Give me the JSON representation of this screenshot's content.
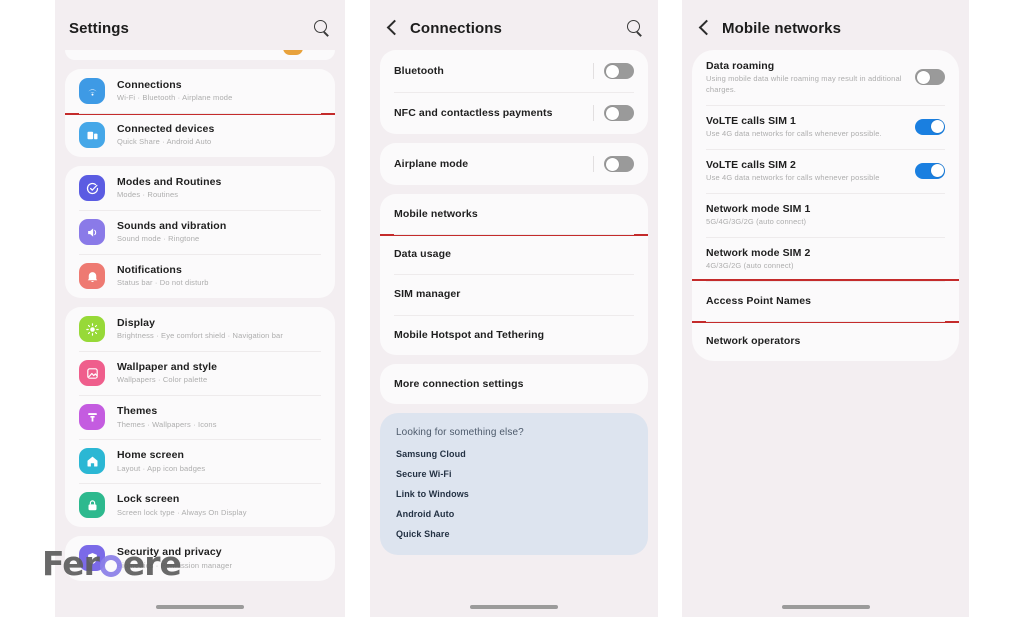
{
  "watermark": {
    "text_before": "Fer",
    "text_after": "ere",
    "badge": "o-circle-icon"
  },
  "colors": {
    "accent_blue": "#1a7fe0",
    "highlight_red": "#c42b2b",
    "panel_bg": "#f3eef1",
    "card_bg": "#fbfafb",
    "suggest_bg": "#dde4ef"
  },
  "panel_settings": {
    "header": {
      "title": "Settings",
      "search_icon": "search-icon"
    },
    "groups": [
      {
        "items": [
          {
            "label": "Connections",
            "sub": "Wi-Fi · Bluetooth · Airplane mode",
            "icon": "wifi-icon",
            "color": "#3e9ae5",
            "highlighted": true
          },
          {
            "label": "Connected devices",
            "sub": "Quick Share · Android Auto",
            "icon": "devices-icon",
            "color": "#45a7e8",
            "highlighted": false
          }
        ]
      },
      {
        "items": [
          {
            "label": "Modes and Routines",
            "sub": "Modes · Routines",
            "icon": "modes-check-icon",
            "color": "#5b5ce2",
            "highlighted": false
          },
          {
            "label": "Sounds and vibration",
            "sub": "Sound mode · Ringtone",
            "icon": "speaker-icon",
            "color": "#8a7ae8",
            "highlighted": false
          },
          {
            "label": "Notifications",
            "sub": "Status bar · Do not disturb",
            "icon": "bell-icon",
            "color": "#ee7a72",
            "highlighted": false
          }
        ]
      },
      {
        "items": [
          {
            "label": "Display",
            "sub": "Brightness · Eye comfort shield · Navigation bar",
            "icon": "brightness-icon",
            "color": "#97d938",
            "highlighted": false
          },
          {
            "label": "Wallpaper and style",
            "sub": "Wallpapers · Color palette",
            "icon": "image-icon",
            "color": "#ef5e8c",
            "highlighted": false
          },
          {
            "label": "Themes",
            "sub": "Themes · Wallpapers · Icons",
            "icon": "themes-icon",
            "color": "#c45ce0",
            "highlighted": false
          },
          {
            "label": "Home screen",
            "sub": "Layout · App icon badges",
            "icon": "home-icon",
            "color": "#2bb7d4",
            "highlighted": false
          },
          {
            "label": "Lock screen",
            "sub": "Screen lock type · Always On Display",
            "icon": "lock-icon",
            "color": "#2db98e",
            "highlighted": false
          }
        ]
      },
      {
        "items": [
          {
            "label": "Security and privacy",
            "sub": "Biometrics · Permission manager",
            "icon": "shield-icon",
            "color": "#7b6ae8",
            "highlighted": false
          }
        ]
      }
    ]
  },
  "panel_connections": {
    "header": {
      "title": "Connections",
      "back_icon": "back-chevron-icon",
      "search_icon": "search-icon"
    },
    "groups": [
      {
        "items": [
          {
            "label": "Bluetooth",
            "toggle": "off",
            "highlighted": false
          },
          {
            "label": "NFC and contactless payments",
            "toggle": "off",
            "highlighted": false
          }
        ]
      },
      {
        "items": [
          {
            "label": "Airplane mode",
            "toggle": "off",
            "highlighted": false
          }
        ]
      },
      {
        "items": [
          {
            "label": "Mobile networks",
            "toggle": "none",
            "highlighted": true
          },
          {
            "label": "Data usage",
            "toggle": "none",
            "highlighted": false
          },
          {
            "label": "SIM manager",
            "toggle": "none",
            "highlighted": false
          },
          {
            "label": "Mobile Hotspot and Tethering",
            "toggle": "none",
            "highlighted": false
          }
        ]
      },
      {
        "items": [
          {
            "label": "More connection settings",
            "toggle": "none",
            "highlighted": false
          }
        ]
      }
    ],
    "suggest": {
      "title": "Looking for something else?",
      "items": [
        "Samsung Cloud",
        "Secure Wi-Fi",
        "Link to Windows",
        "Android Auto",
        "Quick Share"
      ]
    }
  },
  "panel_mobile": {
    "header": {
      "title": "Mobile networks",
      "back_icon": "back-chevron-icon"
    },
    "items": [
      {
        "label": "Data roaming",
        "sub": "Using mobile data while roaming may result in additional charges.",
        "toggle": "off",
        "highlighted": false
      },
      {
        "label": "VoLTE calls SIM 1",
        "sub": "Use 4G data networks for calls whenever possible.",
        "toggle": "on",
        "highlighted": false
      },
      {
        "label": "VoLTE calls SIM 2",
        "sub": "Use 4G data networks for calls whenever possible",
        "toggle": "on",
        "highlighted": false
      },
      {
        "label": "Network mode SIM 1",
        "sub": "5G/4G/3G/2G (auto connect)",
        "toggle": "none",
        "highlighted": false
      },
      {
        "label": "Network mode SIM 2",
        "sub": "4G/3G/2G (auto connect)",
        "toggle": "none",
        "highlighted": false
      },
      {
        "label": "Access Point Names",
        "sub": "",
        "toggle": "none",
        "highlighted": true
      },
      {
        "label": "Network operators",
        "sub": "",
        "toggle": "none",
        "highlighted": false
      }
    ]
  }
}
